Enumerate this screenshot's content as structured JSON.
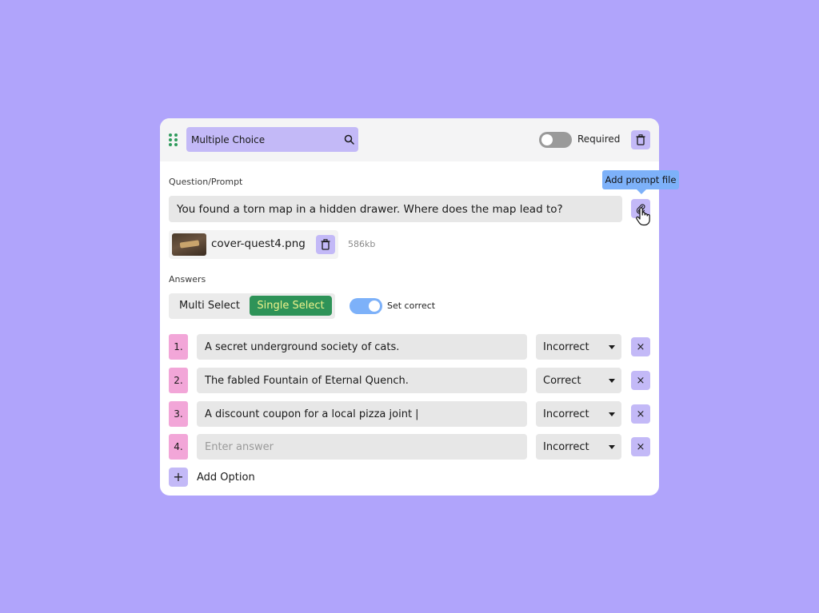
{
  "header": {
    "question_type": "Multiple Choice",
    "required_label": "Required",
    "required_on": false
  },
  "prompt": {
    "section_label": "Question/Prompt",
    "text": "You found a torn map in a hidden drawer. Where does the map lead to?",
    "tooltip": "Add prompt file"
  },
  "attachment": {
    "file_name": "cover-quest4.png",
    "file_size": "586kb"
  },
  "answers": {
    "section_label": "Answers",
    "mode_multi": "Multi Select",
    "mode_single": "Single Select",
    "selected_mode": "Single Select",
    "set_correct_label": "Set correct",
    "set_correct_on": true,
    "items": [
      {
        "num": "1.",
        "text": "A secret underground society of cats.",
        "status": "Incorrect",
        "remove": "×"
      },
      {
        "num": "2.",
        "text": "The fabled Fountain of Eternal Quench.",
        "status": "Correct",
        "remove": "×"
      },
      {
        "num": "3.",
        "text": "A discount coupon for a local pizza joint |",
        "status": "Incorrect",
        "remove": "×"
      },
      {
        "num": "4.",
        "text": "",
        "placeholder": "Enter answer",
        "status": "Incorrect",
        "remove": "×"
      }
    ],
    "add_icon": "+",
    "add_label": "Add Option"
  },
  "colors": {
    "background": "#b0a4fb",
    "accent_lavender": "#c3b9f7",
    "number_pink": "#f2a6d8",
    "single_select_green": "#2e9358",
    "toggle_blue": "#7db1f9",
    "drag_handle_green": "#2e9a5b"
  },
  "icons": {
    "drag": "drag-handle-icon",
    "search": "search-icon",
    "delete": "trash-icon",
    "attach": "paperclip-icon",
    "remove": "close-icon",
    "add": "plus-icon",
    "cursor": "hand-pointer-icon"
  }
}
